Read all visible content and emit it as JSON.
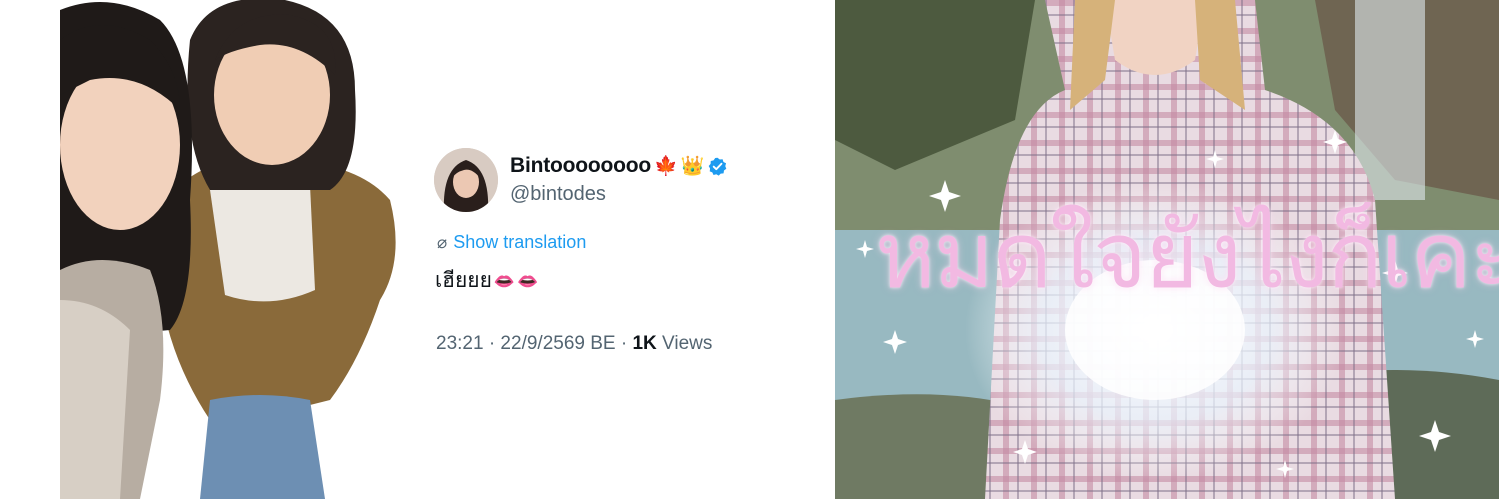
{
  "tweet": {
    "display_name": "Bintoooooooo",
    "name_emojis": [
      "🍁",
      "👑"
    ],
    "handle": "@bintodes",
    "verified_icon": "verified-badge-icon",
    "translate_icon": "globe-icon",
    "show_translation": "Show translation",
    "text": "เฮียยย",
    "text_emojis": [
      "👄",
      "👄"
    ],
    "meta_time": "23:21 · 22/9/2569 BE · ",
    "meta_views_count": "1K",
    "meta_views_label": " Views"
  },
  "overlay": {
    "text": "หมดใจยังไงก็เคะ",
    "color": "#f2b9e2"
  },
  "colors": {
    "link": "#1d9bf0",
    "secondary_text": "#536471",
    "primary_text": "#0f1419",
    "verified": "#1d9bf0"
  }
}
